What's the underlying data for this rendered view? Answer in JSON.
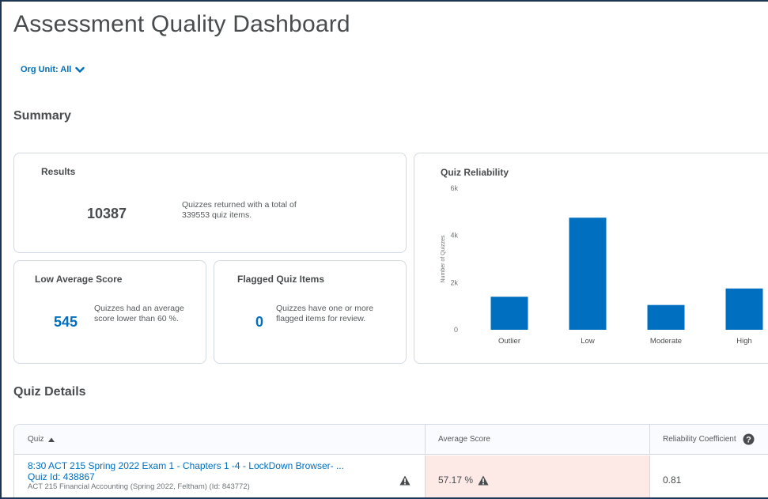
{
  "header": {
    "title": "Assessment Quality Dashboard",
    "org_unit_label": "Org Unit: All"
  },
  "summary": {
    "heading": "Summary",
    "results": {
      "title": "Results",
      "count": "10387",
      "description": "Quizzes returned with a total of 339553 quiz items."
    },
    "low_average": {
      "title": "Low Average Score",
      "count": "545",
      "description": "Quizzes had an average score lower than 60 %."
    },
    "flagged": {
      "title": "Flagged Quiz Items",
      "count": "0",
      "description": "Quizzes have one or more flagged items for review."
    }
  },
  "chart_data": {
    "type": "bar",
    "title": "Quiz Reliability",
    "ylabel": "Number of Quizzes",
    "xlabel": "",
    "categories": [
      "Outlier",
      "Low",
      "Moderate",
      "High"
    ],
    "values": [
      1400,
      4750,
      1050,
      1750
    ],
    "ylim": [
      0,
      6000
    ],
    "yticks": [
      0,
      2000,
      4000,
      6000
    ],
    "ytick_labels": [
      "0",
      "2k",
      "4k",
      "6k"
    ],
    "grid": false,
    "bar_color": "#006fbf"
  },
  "details": {
    "heading": "Quiz Details",
    "columns": {
      "quiz": "Quiz",
      "average_score": "Average Score",
      "reliability": "Reliability Coefficient"
    },
    "rows": [
      {
        "quiz_name": "8:30 ACT 215 Spring 2022 Exam 1 - Chapters 1 -4 - LockDown Browser- ...",
        "quiz_id": "Quiz Id: 438867",
        "course": "ACT 215 Financial Accounting (Spring 2022, Feltham) (Id: 843772)",
        "average_score": "57.17 %",
        "reliability": "0.81"
      }
    ]
  },
  "colors": {
    "accent": "#006fbf",
    "border": "#d3d9e3",
    "warning_bg": "#fde9e6",
    "text": "#494c4e"
  }
}
